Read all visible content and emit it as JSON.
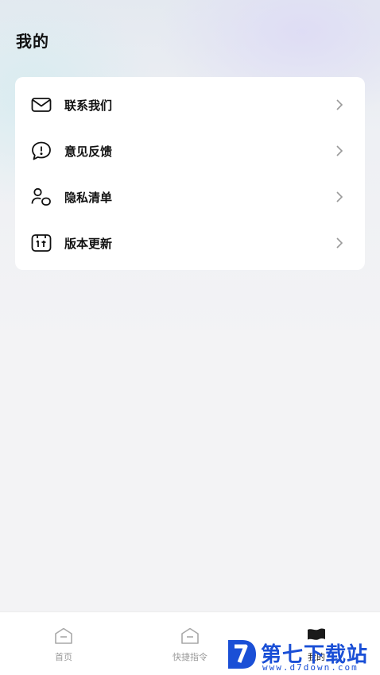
{
  "header": {
    "title": "我的"
  },
  "menu": {
    "items": [
      {
        "label": "联系我们",
        "icon": "mail-icon"
      },
      {
        "label": "意见反馈",
        "icon": "feedback-icon"
      },
      {
        "label": "隐私清单",
        "icon": "privacy-icon"
      },
      {
        "label": "版本更新",
        "icon": "update-icon"
      }
    ]
  },
  "tabbar": {
    "tabs": [
      {
        "label": "首页",
        "icon": "home-icon",
        "active": false
      },
      {
        "label": "快捷指令",
        "icon": "shortcut-icon",
        "active": false
      },
      {
        "label": "我的",
        "icon": "flag-icon",
        "active": true
      }
    ]
  },
  "watermark": {
    "text": "第七下载站",
    "url": "www.d7down.com",
    "color": "#1a4fd6"
  }
}
